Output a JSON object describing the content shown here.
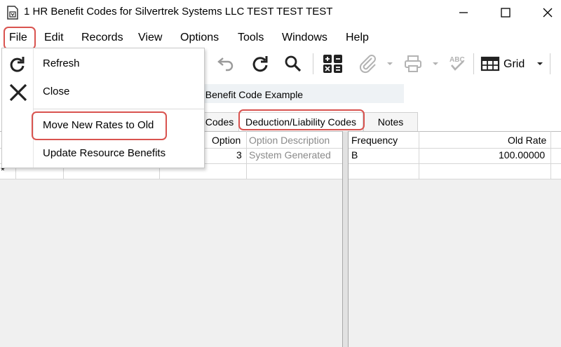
{
  "window": {
    "title": "1 HR Benefit Codes for Silvertrek Systems LLC TEST TEST TEST",
    "minimize_icon": "minimize-icon",
    "maximize_icon": "maximize-icon",
    "close_icon": "close-icon"
  },
  "menubar": {
    "items": [
      "File",
      "Edit",
      "Records",
      "View",
      "Options",
      "Tools",
      "Windows",
      "Help"
    ]
  },
  "file_menu": {
    "items": [
      {
        "label": "Refresh",
        "icon": "refresh-icon"
      },
      {
        "label": "Close",
        "icon": "close-x-icon"
      },
      {
        "label": "Move New Rates to Old",
        "icon": ""
      },
      {
        "label": "Update Resource Benefits",
        "icon": ""
      }
    ]
  },
  "toolbar": {
    "grid_label": "Grid",
    "icons": [
      "undo-icon",
      "refresh-icon",
      "search-icon",
      "calculator-icon",
      "attachment-icon",
      "print-icon",
      "spellcheck-icon",
      "grid-icon"
    ]
  },
  "form": {
    "description": "al Benefit Code Example"
  },
  "tabs": [
    "Codes",
    "Deduction/Liability Codes",
    "Notes"
  ],
  "left_grid": {
    "headers": [
      "Option",
      "Option Description"
    ],
    "rows": [
      [
        "3",
        "System Generated"
      ]
    ]
  },
  "right_grid": {
    "headers": [
      "Frequency",
      "Old Rate"
    ],
    "rows": [
      [
        "B",
        "100.00000"
      ]
    ]
  },
  "new_row_marker": "*",
  "colors": {
    "highlight": "#d9534f",
    "field_bg": "#eef2f5",
    "grid_bg": "#f0f0f0"
  }
}
